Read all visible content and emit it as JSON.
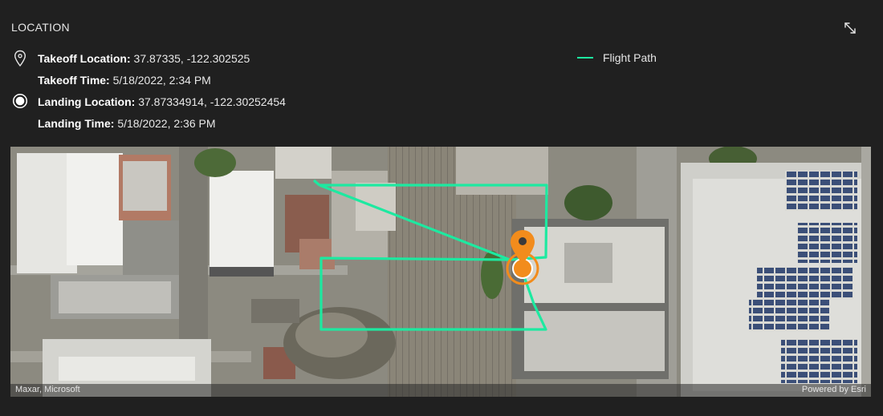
{
  "panel": {
    "title": "LOCATION",
    "expand_icon": "expand-diagonal-icon"
  },
  "takeoff": {
    "location_label": "Takeoff Location:",
    "location_value": "37.87335, -122.302525",
    "time_label": "Takeoff Time:",
    "time_value": "5/18/2022, 2:34 PM",
    "icon": "map-pin-outline-icon"
  },
  "landing": {
    "location_label": "Landing Location:",
    "location_value": "37.87334914, -122.30252454",
    "time_label": "Landing Time:",
    "time_value": "5/18/2022, 2:36 PM",
    "icon": "radio-target-icon"
  },
  "legend": {
    "label": "Flight Path",
    "color": "#1de9a0"
  },
  "map": {
    "attribution_left": "Maxar, Microsoft",
    "attribution_right": "Powered by Esri",
    "marker_color": "#f28c1c",
    "path_color": "#1de9a0"
  }
}
